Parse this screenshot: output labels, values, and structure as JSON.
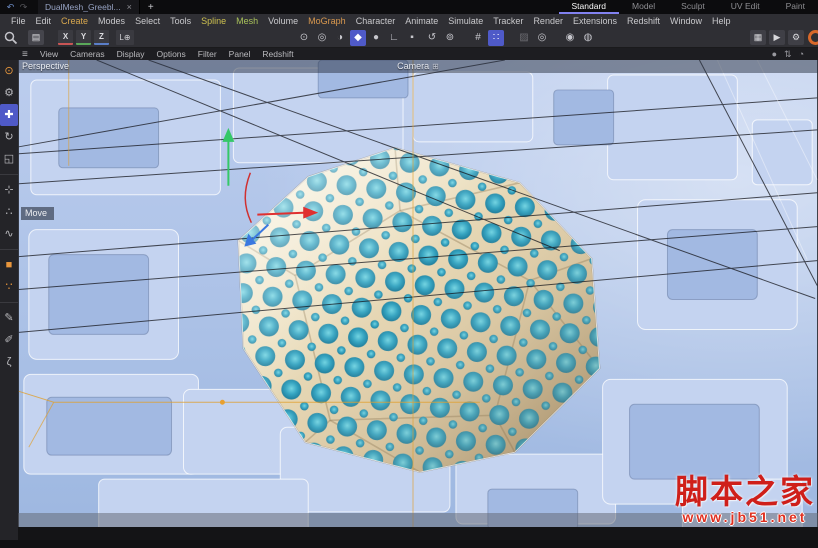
{
  "title_bar": {
    "undo_glyph": "↶",
    "redo_glyph": "↷",
    "document_tab": {
      "label": "DualMesh_Greebl...",
      "close_glyph": "×"
    },
    "new_tab_glyph": "+",
    "layout_tabs": [
      {
        "label": "Standard",
        "active": true
      },
      {
        "label": "Model"
      },
      {
        "label": "Sculpt"
      },
      {
        "label": "UV Edit"
      },
      {
        "label": "Paint"
      }
    ]
  },
  "menubar": {
    "items": [
      {
        "label": "File"
      },
      {
        "label": "Edit"
      },
      {
        "label": "Create",
        "color": "#d9a84e"
      },
      {
        "label": "Modes"
      },
      {
        "label": "Select"
      },
      {
        "label": "Tools"
      },
      {
        "label": "Spline",
        "color": "#cdc04f"
      },
      {
        "label": "Mesh",
        "color": "#a9c25a"
      },
      {
        "label": "Volume"
      },
      {
        "label": "MoGraph",
        "color": "#d9984e"
      },
      {
        "label": "Character"
      },
      {
        "label": "Animate"
      },
      {
        "label": "Simulate"
      },
      {
        "label": "Tracker"
      },
      {
        "label": "Render"
      },
      {
        "label": "Extensions"
      },
      {
        "label": "Redshift"
      },
      {
        "label": "Window"
      },
      {
        "label": "Help"
      }
    ]
  },
  "toolbar": {
    "frame_icon_glyph": "▤",
    "axis_locks": [
      {
        "label": "X",
        "color": "#c85555"
      },
      {
        "label": "Y",
        "color": "#5aa85a"
      },
      {
        "label": "Z",
        "color": "#5a7ec8"
      }
    ],
    "workplane_lock_label": "L⊕",
    "mode_icons": [
      {
        "name": "make-editable-icon",
        "glyph": "⊙"
      },
      {
        "name": "model-mode-icon",
        "glyph": "◎"
      },
      {
        "name": "texture-mode-icon",
        "glyph": "◑"
      },
      {
        "name": "polygon-mode-icon",
        "glyph": "◆",
        "active": true
      },
      {
        "name": "enable-axis-icon",
        "glyph": "●"
      },
      {
        "name": "axis-corner-icon",
        "glyph": "∟"
      },
      {
        "name": "workplane-icon",
        "glyph": "▪"
      }
    ],
    "snap_icons": [
      {
        "name": "coordinate-system-icon",
        "glyph": "↺"
      },
      {
        "name": "object-axis-icon",
        "glyph": "⊚"
      },
      {
        "name": "grid-snap-icon",
        "glyph": "#",
        "gap_before": true
      },
      {
        "name": "snap-toggle-icon",
        "glyph": "∷",
        "active": true
      },
      {
        "name": "workplane-snap-icon",
        "glyph": "▨",
        "dim": true,
        "gap_before": true
      },
      {
        "name": "dynamic-guides-icon",
        "glyph": "◎"
      },
      {
        "name": "capsule-a-icon",
        "glyph": "◉",
        "gap_before": true
      },
      {
        "name": "capsule-b-icon",
        "glyph": "◍"
      }
    ],
    "render_icons": [
      {
        "name": "render-view-icon",
        "glyph": "▦"
      },
      {
        "name": "render-picture-viewer-icon",
        "glyph": "▶"
      },
      {
        "name": "render-settings-icon",
        "glyph": "⚙"
      }
    ],
    "redshift_ring_color": "#d8682a"
  },
  "viewport_menu": {
    "hamburger_glyph": "≡",
    "items": [
      {
        "label": "View"
      },
      {
        "label": "Cameras"
      },
      {
        "label": "Display"
      },
      {
        "label": "Options"
      },
      {
        "label": "Filter"
      },
      {
        "label": "Panel"
      },
      {
        "label": "Redshift"
      }
    ],
    "right_icons": [
      {
        "name": "solo-sphere-icon",
        "glyph": "●"
      },
      {
        "name": "swap-views-icon",
        "glyph": "⇅"
      },
      {
        "name": "view-history-icon",
        "glyph": "◔"
      }
    ]
  },
  "left_toolbar": {
    "tools": [
      {
        "name": "live-selection-tool",
        "glyph": "⊙",
        "orange": true
      },
      {
        "name": "tweak-tool",
        "glyph": "⚙"
      },
      {
        "name": "move-tool",
        "glyph": "✚",
        "active": true
      },
      {
        "name": "rotate-tool",
        "glyph": "↻"
      },
      {
        "name": "scale-tool",
        "glyph": "◱"
      },
      {
        "sep": true
      },
      {
        "name": "transform-tool",
        "glyph": "⊹"
      },
      {
        "name": "randomize-tool",
        "glyph": "∴"
      },
      {
        "name": "smooth-tool",
        "glyph": "∿"
      },
      {
        "sep": true
      },
      {
        "name": "rectangle-select-tool",
        "glyph": "■",
        "orange": true
      },
      {
        "name": "cluster-tool",
        "glyph": "∵",
        "orange": true
      },
      {
        "sep": true
      },
      {
        "name": "knife-tool",
        "glyph": "✎"
      },
      {
        "name": "sketch-tool",
        "glyph": "✐"
      },
      {
        "name": "spline-pen-tool",
        "glyph": "ζ"
      }
    ]
  },
  "viewport": {
    "view_label": "Perspective",
    "camera_label": "Camera",
    "camera_icon_glyph": "⊞",
    "tool_hint": "Move"
  },
  "watermark": {
    "title": "脚本之家",
    "url": "www.jb51.net"
  },
  "colors": {
    "active_highlight": "#4f5ac8",
    "layout_tab_underline": "#8282f0",
    "selection_orange": "#e8963c",
    "watermark_red": "#cf1f1a",
    "hole_teal": "#2f9ab8",
    "metal_light": "#f8f1df",
    "metal_dark": "#b39a72",
    "scene_blue": "#aec4e8"
  }
}
